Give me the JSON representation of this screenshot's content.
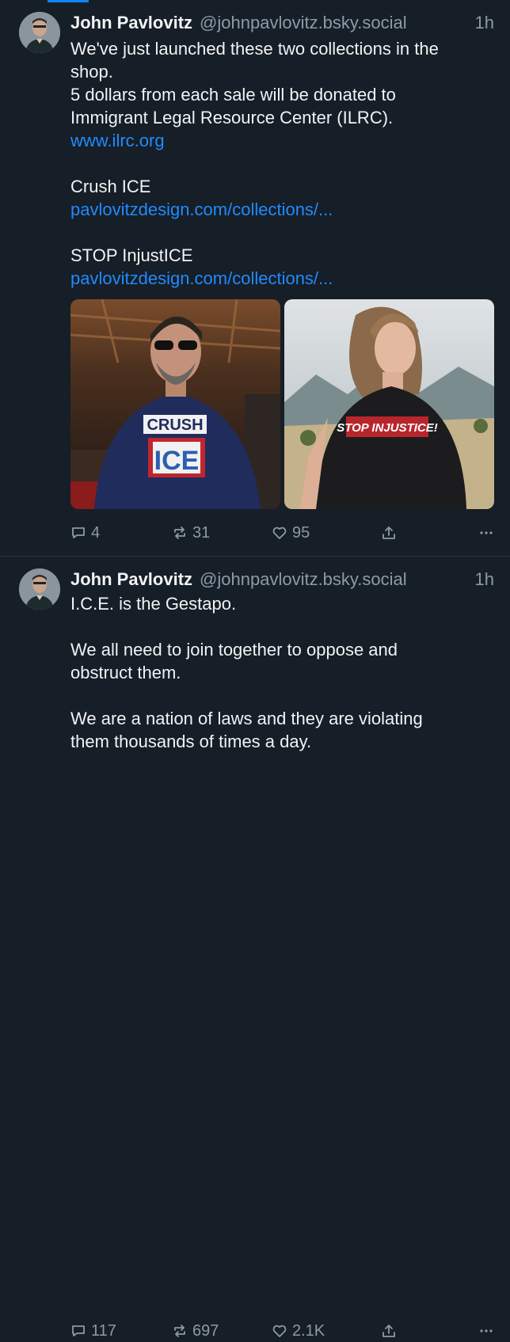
{
  "post1": {
    "author_name": "John Pavlovitz",
    "handle": "@johnpavlovitz.bsky.social",
    "time": "1h",
    "lines": [
      "We've just launched these two collections in the",
      "shop.",
      "5 dollars from each sale will be donated to",
      "Immigrant Legal Resource Center (ILRC)."
    ],
    "link1": "www.ilrc.org",
    "section1_title": "Crush ICE",
    "section1_link": "pavlovitzdesign.com/collections/...",
    "section2_title": "STOP InjustICE",
    "section2_link": "pavlovitzdesign.com/collections/...",
    "image1_text": {
      "line1": "CRUSH",
      "line2": "ICE"
    },
    "image2_text": {
      "line1": "STOP INJUSTICE!"
    },
    "stats": {
      "replies": "4",
      "reposts": "31",
      "likes": "95"
    }
  },
  "post2": {
    "author_name": "John Pavlovitz",
    "handle": "@johnpavlovitz.bsky.social",
    "time": "1h",
    "line1": "I.C.E. is the Gestapo.",
    "line2": "We all need to join together to oppose and",
    "line3": "obstruct them.",
    "line4": "We are a nation of laws and they are violating",
    "line5": "them thousands of times a day.",
    "stats": {
      "replies": "117",
      "reposts": "697",
      "likes": "2.1K"
    }
  },
  "colors": {
    "background": "#161e27",
    "text": "#f1f3f5",
    "muted": "#8d9aa8",
    "link": "#208bfe",
    "accent": "#1083fe"
  },
  "icons": {
    "reply": "speech-bubble-icon",
    "repost": "repost-arrows-icon",
    "like": "heart-icon",
    "share": "share-upload-icon",
    "more": "ellipsis-icon"
  }
}
